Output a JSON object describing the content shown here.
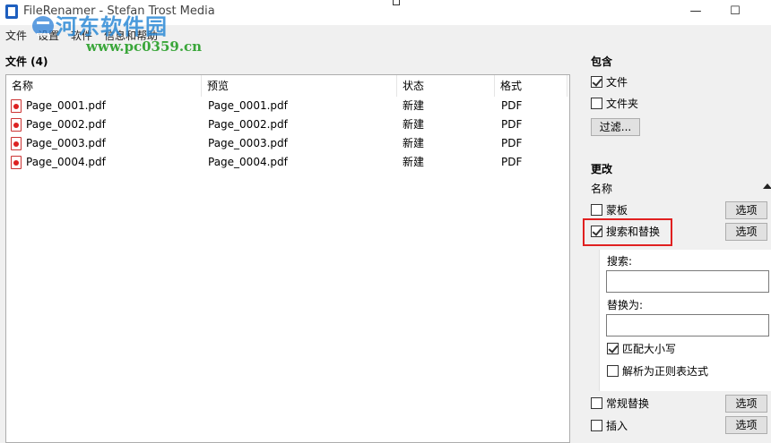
{
  "titlebar": {
    "title": "FileRenamer - Stefan Trost Media",
    "minimize": "—",
    "maximize": "☐"
  },
  "watermark": {
    "title": "河东软件园",
    "url": "www.pc0359.cn"
  },
  "menubar": {
    "items": [
      "文件",
      "设置",
      "软件",
      "信息和帮助"
    ]
  },
  "files": {
    "label": "文件 (4)",
    "columns": [
      "名称",
      "预览",
      "状态",
      "格式"
    ],
    "rows": [
      {
        "name": "Page_0001.pdf",
        "preview": "Page_0001.pdf",
        "status": "新建",
        "format": "PDF"
      },
      {
        "name": "Page_0002.pdf",
        "preview": "Page_0002.pdf",
        "status": "新建",
        "format": "PDF"
      },
      {
        "name": "Page_0003.pdf",
        "preview": "Page_0003.pdf",
        "status": "新建",
        "format": "PDF"
      },
      {
        "name": "Page_0004.pdf",
        "preview": "Page_0004.pdf",
        "status": "新建",
        "format": "PDF"
      }
    ]
  },
  "sidebar": {
    "include_heading": "包含",
    "include_files": {
      "label": "文件",
      "checked": true
    },
    "include_folders": {
      "label": "文件夹",
      "checked": false
    },
    "filter_button": "过滤...",
    "change_heading": "更改",
    "name_heading": "名称",
    "template": {
      "label": "蒙板",
      "checked": false,
      "button": "选项"
    },
    "search_replace": {
      "label": "搜索和替换",
      "checked": true,
      "button": "选项",
      "search_label": "搜索:",
      "search_value": "",
      "replace_label": "替换为:",
      "replace_value": "",
      "match_case": {
        "label": "匹配大小写",
        "checked": true
      },
      "regex": {
        "label": "解析为正则表达式",
        "checked": false
      }
    },
    "regular_replace": {
      "label": "常规替换",
      "checked": false,
      "button": "选项"
    },
    "insert": {
      "label": "插入",
      "checked": false,
      "button": "选项"
    }
  }
}
